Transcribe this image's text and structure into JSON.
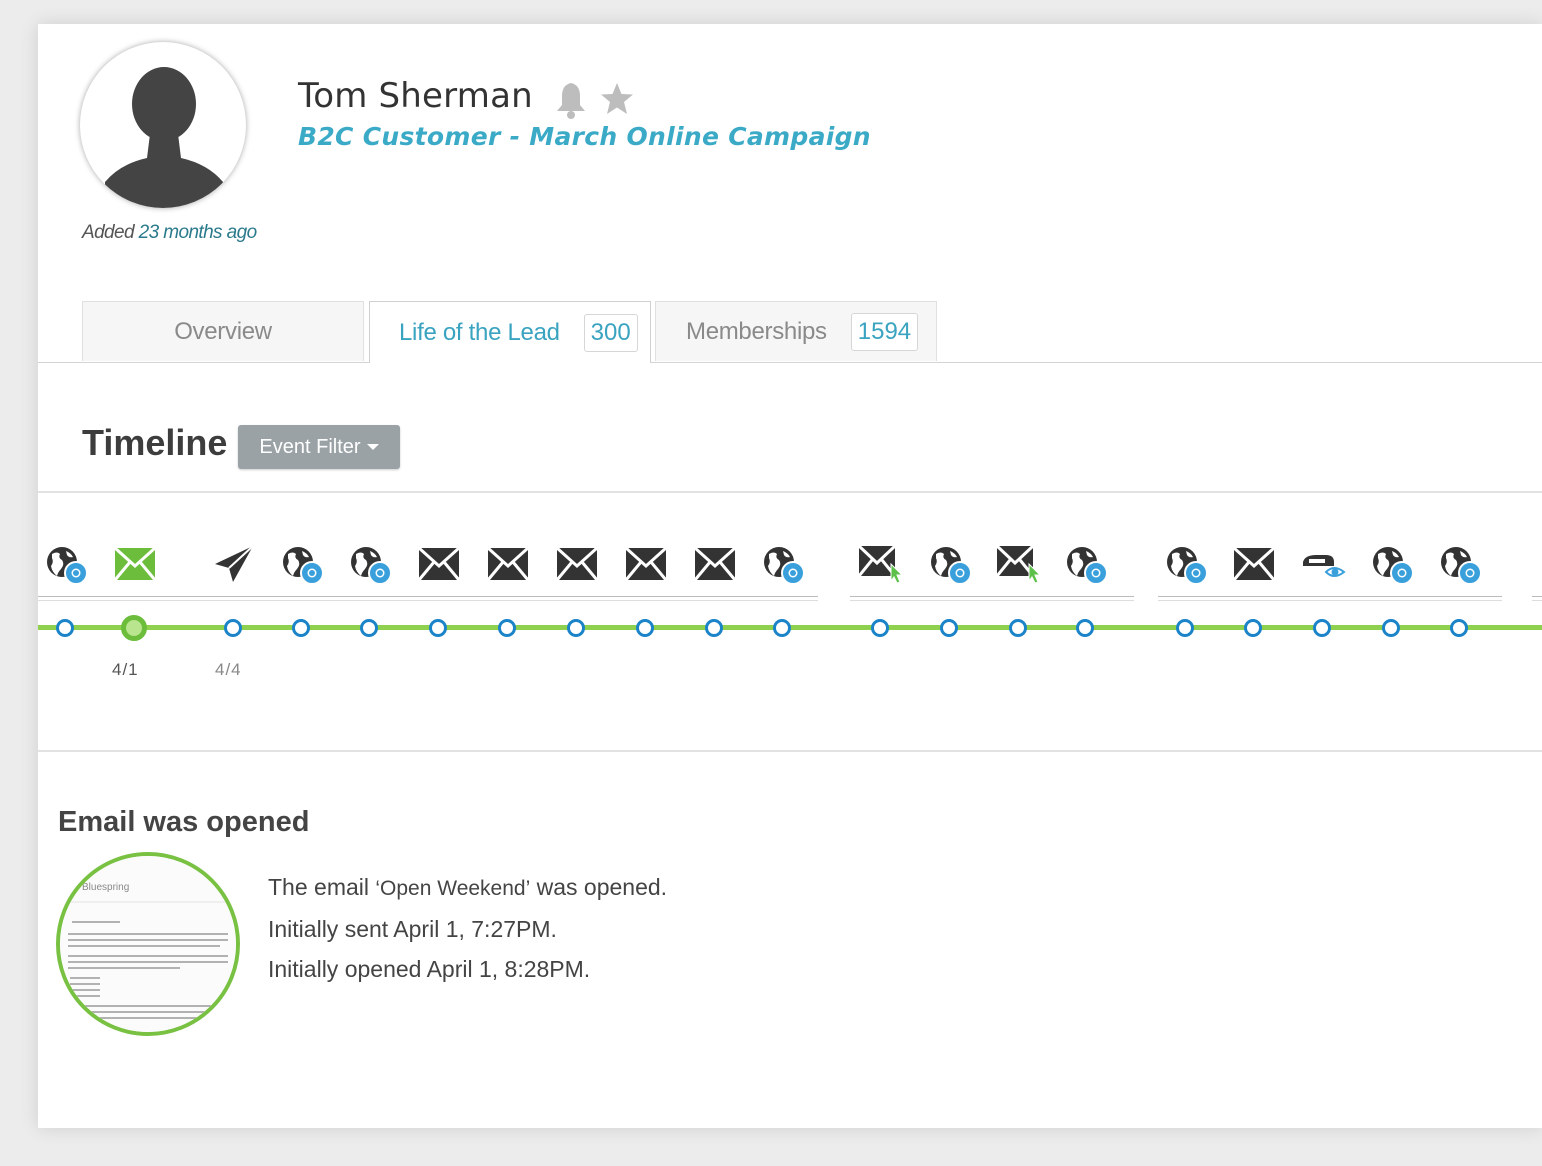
{
  "profile": {
    "name": "Tom Sherman",
    "subtitle": "B2C Customer - March Online Campaign",
    "added_prefix": "Added",
    "added_time": "23 months ago"
  },
  "tabs": [
    {
      "label": "Overview"
    },
    {
      "label": "Life of the Lead",
      "count": "300"
    },
    {
      "label": "Memberships",
      "count": "1594"
    }
  ],
  "timeline": {
    "title": "Timeline",
    "filter_label": "Event Filter",
    "dates": [
      "4/1",
      "4/4"
    ],
    "event_icons": [
      "globe-chrome-icon",
      "email-opened-icon",
      "send-icon",
      "globe-chrome-icon",
      "globe-chrome-icon",
      "email-icon",
      "email-icon",
      "email-icon",
      "email-icon",
      "email-icon",
      "globe-chrome-icon",
      "email-click-icon",
      "globe-chrome-icon",
      "email-click-icon",
      "globe-chrome-icon",
      "globe-chrome-icon",
      "email-icon",
      "view-icon",
      "globe-chrome-icon",
      "globe-chrome-icon"
    ]
  },
  "detail": {
    "title": "Email was opened",
    "line1_prefix": "The email ",
    "line1_name": "‘Open Weekend’",
    "line1_suffix": " was opened.",
    "line2": "Initially sent April 1, 7:27PM.",
    "line3": "Initially opened April 1, 8:28PM.",
    "thumb_brand": "Bluespring"
  },
  "colors": {
    "accent": "#3aa3c0",
    "track_green": "#8fd14f",
    "node_blue": "#1b84c9",
    "selected_green": "#6cbd3c",
    "filter_button": "#9aa2a6"
  }
}
